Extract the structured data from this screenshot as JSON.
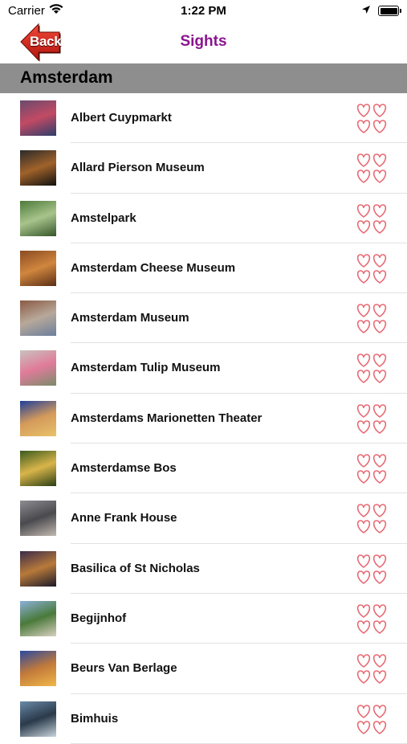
{
  "status": {
    "carrier": "Carrier",
    "time": "1:22 PM"
  },
  "nav": {
    "back_label": "Back",
    "title": "Sights"
  },
  "section": {
    "title": "Amsterdam"
  },
  "items": [
    {
      "label": "Albert Cuypmarkt",
      "colors": [
        "#6a4b6d",
        "#c24a64",
        "#2c3e6a"
      ]
    },
    {
      "label": "Allard Pierson Museum",
      "colors": [
        "#2a2a2a",
        "#a0622a",
        "#111111"
      ]
    },
    {
      "label": "Amstelpark",
      "colors": [
        "#4d7a3a",
        "#a8c48c",
        "#35562a"
      ]
    },
    {
      "label": "Amsterdam Cheese Museum",
      "colors": [
        "#8a4b22",
        "#d0863e",
        "#5a2e14"
      ]
    },
    {
      "label": "Amsterdam Museum",
      "colors": [
        "#8a5a44",
        "#b8a89a",
        "#6a7f9c"
      ]
    },
    {
      "label": "Amsterdam Tulip Museum",
      "colors": [
        "#c9c2bd",
        "#e07b9a",
        "#7a8c6a"
      ]
    },
    {
      "label": "Amsterdams Marionetten Theater",
      "colors": [
        "#1f3f9a",
        "#d49a5a",
        "#e8c26a"
      ]
    },
    {
      "label": "Amsterdamse Bos",
      "colors": [
        "#3a5a1e",
        "#d9b54a",
        "#2a3e14"
      ]
    },
    {
      "label": "Anne Frank House",
      "colors": [
        "#8c8c92",
        "#4a4a4e",
        "#c2b8b0"
      ]
    },
    {
      "label": "Basilica of St Nicholas",
      "colors": [
        "#3a2a4a",
        "#b87a3a",
        "#1a1a2a"
      ]
    },
    {
      "label": "Begijnhof",
      "colors": [
        "#8ab0d8",
        "#4a7a3a",
        "#d8d0c0"
      ]
    },
    {
      "label": "Beurs Van Berlage",
      "colors": [
        "#2a4aa0",
        "#c27a3a",
        "#f0b84a"
      ]
    },
    {
      "label": "Bimhuis",
      "colors": [
        "#6a8aa8",
        "#2a3a4a",
        "#c8d4dc"
      ]
    }
  ]
}
